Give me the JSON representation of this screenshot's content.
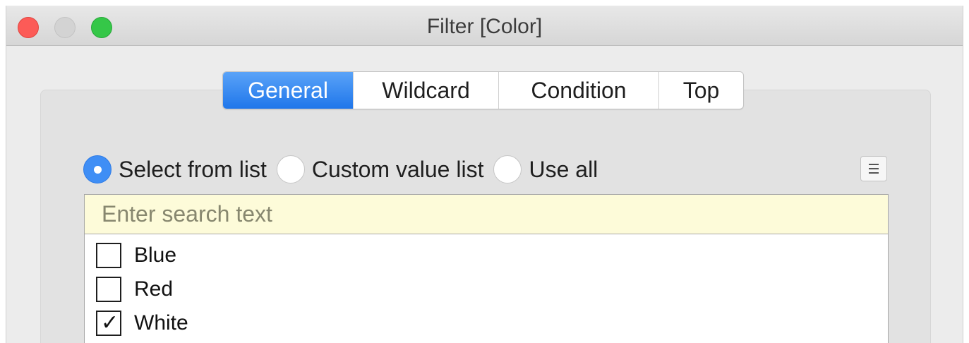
{
  "window": {
    "title": "Filter [Color]"
  },
  "tabs": [
    {
      "label": "General",
      "active": true
    },
    {
      "label": "Wildcard",
      "active": false
    },
    {
      "label": "Condition",
      "active": false
    },
    {
      "label": "Top",
      "active": false
    }
  ],
  "radios": [
    {
      "label": "Select from list",
      "checked": true
    },
    {
      "label": "Custom value list",
      "checked": false
    },
    {
      "label": "Use all",
      "checked": false
    }
  ],
  "search": {
    "placeholder": "Enter search text",
    "value": ""
  },
  "list": [
    {
      "label": "Blue",
      "checked": false
    },
    {
      "label": "Red",
      "checked": false
    },
    {
      "label": "White",
      "checked": true
    }
  ],
  "icons": {
    "close": "close-icon",
    "minimize": "minimize-icon",
    "zoom": "zoom-icon",
    "menu": "list-menu-icon",
    "check": "checkmark-icon"
  },
  "colors": {
    "accent": "#1f76ea",
    "close": "#fc5b57",
    "zoom": "#35c748",
    "search_bg": "#fdfbd9",
    "window_bg": "#ececec"
  }
}
